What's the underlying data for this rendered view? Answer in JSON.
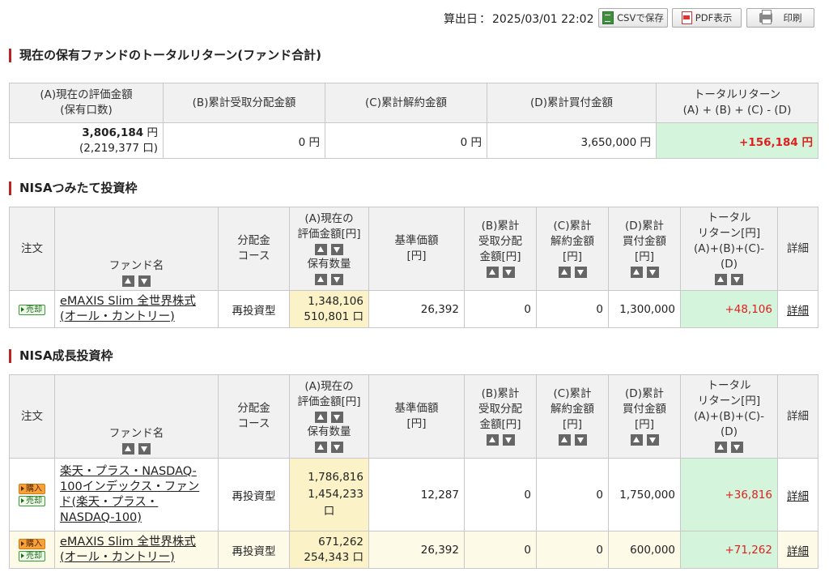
{
  "header": {
    "calc_date_label": "算出日",
    "calc_date_value": "2025/03/01 22:02",
    "csv_button": "CSVで保存",
    "pdf_button": "PDF表示",
    "print_button": "印刷"
  },
  "summary": {
    "title": "現在の保有ファンドのトータルリターン(ファンド合計)",
    "headers": {
      "a_line1": "(A)現在の評価金額",
      "a_line2": "(保有口数)",
      "b": "(B)累計受取分配金額",
      "c": "(C)累計解約金額",
      "d": "(D)累計買付金額",
      "total_line1": "トータルリターン",
      "total_line2": "(A) + (B) + (C) - (D)"
    },
    "values": {
      "a_amount": "3,806,184",
      "a_units": "(2,219,377 口)",
      "b": "0 円",
      "c": "0 円",
      "d": "3,650,000 円",
      "total": "+156,184 円"
    },
    "yen": "円"
  },
  "columns": {
    "order": "注文",
    "fund_name": "ファンド名",
    "dist_line1": "分配金",
    "dist_line2": "コース",
    "a_line1": "(A)現在の",
    "a_line2": "評価金額[円]",
    "a_line3": "保有数量",
    "base_line1": "基準価額",
    "base_line2": "[円]",
    "b_line1": "(B)累計",
    "b_line2": "受取分配",
    "b_line3": "金額[円]",
    "c_line1": "(C)累計",
    "c_line2": "解約金額",
    "c_line3": "[円]",
    "d_line1": "(D)累計",
    "d_line2": "買付金額",
    "d_line3": "[円]",
    "tr_line1": "トータル",
    "tr_line2": "リターン[円]",
    "tr_line3": "(A)+(B)+(C)-(D)",
    "detail": "詳細"
  },
  "buttons": {
    "sell": "売却",
    "buy": "購入",
    "detail_link": "詳細"
  },
  "tsumitate": {
    "title": "NISAつみたて投資枠",
    "rows": [
      {
        "fund_line1": "eMAXIS Slim 全世界株式",
        "fund_line2": "(オール・カントリー)",
        "course": "再投資型",
        "a_amount": "1,348,106",
        "a_units": "510,801 口",
        "base": "26,392",
        "b": "0",
        "c": "0",
        "d": "1,300,000",
        "total": "+48,106"
      }
    ]
  },
  "growth": {
    "title": "NISA成長投資枠",
    "rows": [
      {
        "fund_line1": "楽天・プラス・NASDAQ-",
        "fund_line2": "100インデックス・ファン",
        "fund_line3": "ド(楽天・プラス・",
        "fund_line4": "NASDAQ-100)",
        "course": "再投資型",
        "a_amount": "1,786,816",
        "a_units_line1": "1,454,233",
        "a_units_line2": "口",
        "base": "12,287",
        "b": "0",
        "c": "0",
        "d": "1,750,000",
        "total": "+36,816"
      },
      {
        "fund_line1": "eMAXIS Slim 全世界株式",
        "fund_line2": "(オール・カントリー)",
        "course": "再投資型",
        "a_amount": "671,262",
        "a_units": "254,343 口",
        "base": "26,392",
        "b": "0",
        "c": "0",
        "d": "600,000",
        "total": "+71,262"
      }
    ]
  },
  "icons": [
    "csv-icon",
    "pdf-icon",
    "print-icon",
    "sort-up-icon",
    "sort-down-icon"
  ],
  "colors": {
    "accent_bar": "#b22222",
    "positive": "#e02020",
    "total_bg": "#d4f4dc",
    "value_bg": "#fbf3c7"
  }
}
